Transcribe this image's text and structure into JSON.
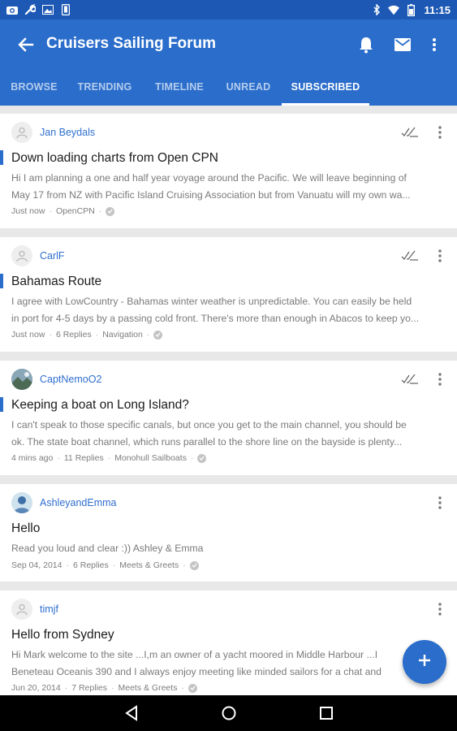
{
  "status_bar": {
    "time": "11:15",
    "left_icons": [
      "camera-icon",
      "wrench-icon",
      "image-icon",
      "phone-icon"
    ],
    "right_icons": [
      "bluetooth-icon",
      "wifi-icon",
      "battery-icon"
    ]
  },
  "app_bar": {
    "title": "Cruisers Sailing Forum",
    "actions": [
      "bell-icon",
      "mail-icon",
      "more-vert-icon"
    ],
    "color": "#2a6dcb"
  },
  "tabs": [
    {
      "label": "BROWSE",
      "active": false
    },
    {
      "label": "TRENDING",
      "active": false
    },
    {
      "label": "TIMELINE",
      "active": false
    },
    {
      "label": "UNREAD",
      "active": false
    },
    {
      "label": "SUBSCRIBED",
      "active": true
    }
  ],
  "posts": [
    {
      "user": "Jan Beydals",
      "title": "Down loading charts from Open CPN",
      "snippet_line1": "Hi I am planning a one and half year voyage around the Pacific. We will leave beginning of",
      "snippet_line2": "May 17 from NZ with Pacific Island Cruising Association but from Vanuatu will my own wa...",
      "time": "Just now",
      "replies": "",
      "forum": "OpenCPN",
      "unread": true,
      "mark_read": true
    },
    {
      "user": "CarlF",
      "title": "Bahamas Route",
      "snippet_line1": "I agree with LowCountry - Bahamas winter weather is unpredictable. You can easily be held",
      "snippet_line2": "in port for 4-5 days by a passing cold front. There's more than enough in Abacos to keep yo...",
      "time": "Just now",
      "replies": "6 Replies",
      "forum": "Navigation",
      "unread": true,
      "mark_read": true
    },
    {
      "user": "CaptNemoO2",
      "title": "Keeping a boat on Long Island?",
      "snippet_line1": "I can't speak to those specific canals, but once you get to the main channel, you should be",
      "snippet_line2": "ok. The state boat channel, which runs parallel to the shore line on the bayside is plenty...",
      "time": "4 mins ago",
      "replies": "11 Replies",
      "forum": "Monohull Sailboats",
      "unread": true,
      "mark_read": true
    },
    {
      "user": "AshleyandEmma",
      "title": "Hello",
      "snippet_line1": "Read you loud and clear :)) Ashley & Emma",
      "snippet_line2": "",
      "time": "Sep 04, 2014",
      "replies": "6 Replies",
      "forum": "Meets & Greets",
      "unread": false,
      "mark_read": false
    },
    {
      "user": "timjf",
      "title": "Hello from Sydney",
      "snippet_line1": "Hi Mark welcome to the site ...I,m an owner of a yacht moored in Middle Harbour ...I",
      "snippet_line2": "Beneteau Oceanis 390 and I always enjoy meeting like minded sailors for a chat and",
      "time": "Jun 20, 2014",
      "replies": "7 Replies",
      "forum": "Meets & Greets",
      "unread": false,
      "mark_read": false
    }
  ],
  "fab": {
    "icon": "plus-icon"
  },
  "nav_bar": [
    "back-triangle-icon",
    "home-circle-icon",
    "recents-square-icon"
  ]
}
